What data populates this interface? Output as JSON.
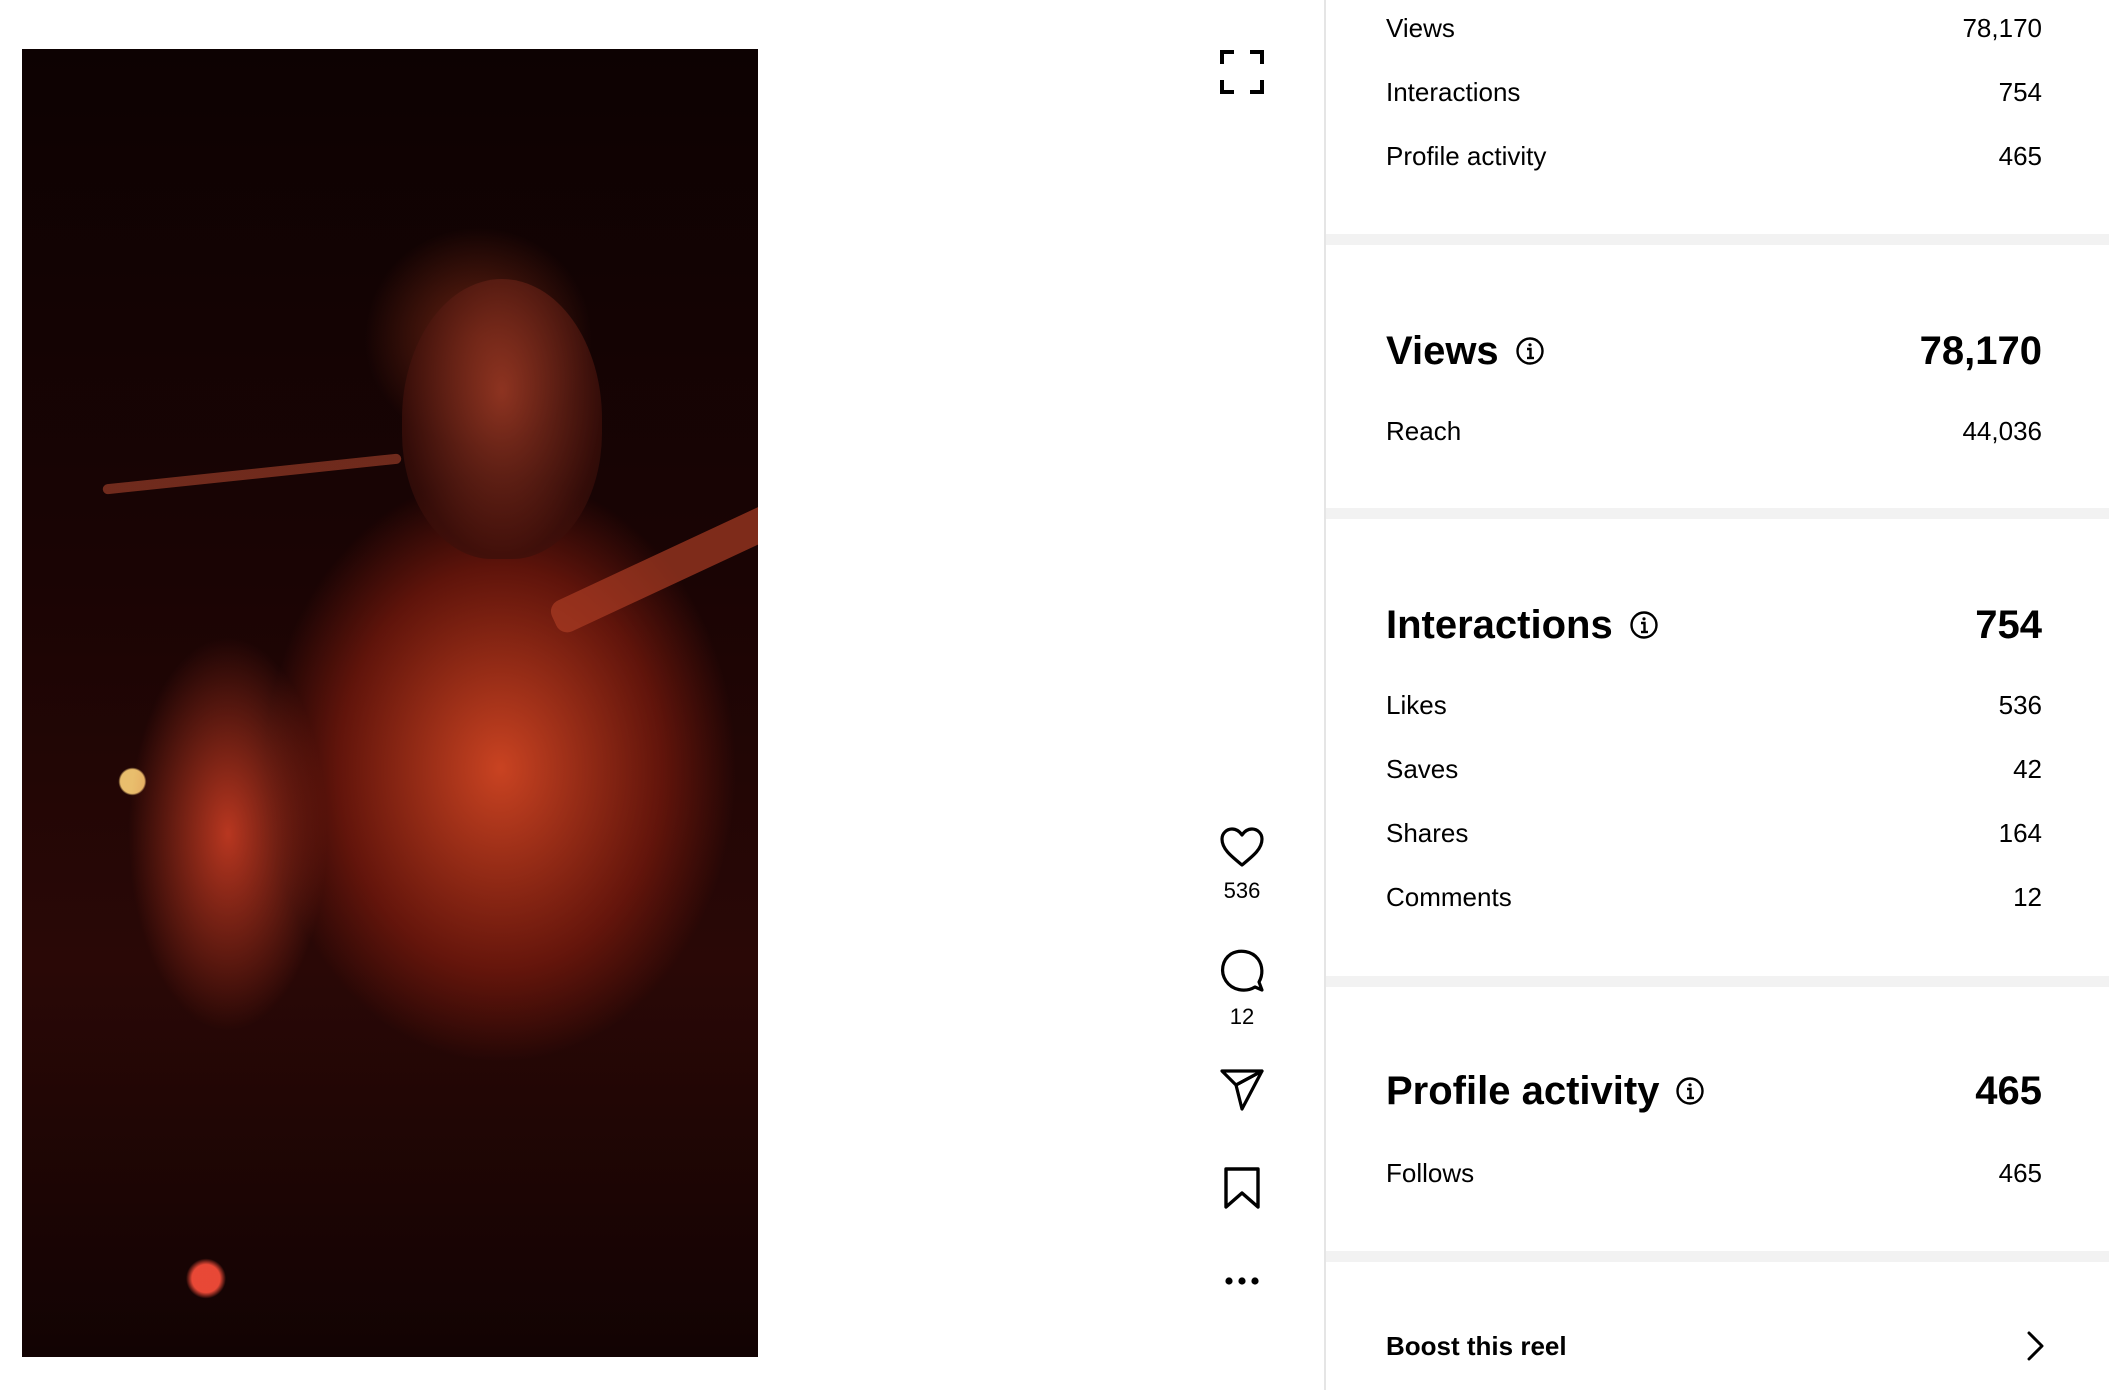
{
  "summary": {
    "rows": [
      {
        "label": "Views",
        "value": "78,170"
      },
      {
        "label": "Interactions",
        "value": "754"
      },
      {
        "label": "Profile activity",
        "value": "465"
      }
    ]
  },
  "views_section": {
    "title": "Views",
    "value": "78,170",
    "rows": [
      {
        "label": "Reach",
        "value": "44,036"
      }
    ]
  },
  "interactions_section": {
    "title": "Interactions",
    "value": "754",
    "rows": [
      {
        "label": "Likes",
        "value": "536"
      },
      {
        "label": "Saves",
        "value": "42"
      },
      {
        "label": "Shares",
        "value": "164"
      },
      {
        "label": "Comments",
        "value": "12"
      }
    ]
  },
  "profile_section": {
    "title": "Profile activity",
    "value": "465",
    "rows": [
      {
        "label": "Follows",
        "value": "465"
      }
    ]
  },
  "actions": {
    "likes_count": "536",
    "comments_count": "12",
    "icons": [
      "expand-icon",
      "heart-icon",
      "comment-icon",
      "share-icon",
      "bookmark-icon",
      "more-icon"
    ]
  },
  "boost": {
    "label": "Boost this reel"
  },
  "colors": {
    "separator": "#f2f2f2",
    "divider": "#e5e5e5",
    "text": "#000000"
  }
}
